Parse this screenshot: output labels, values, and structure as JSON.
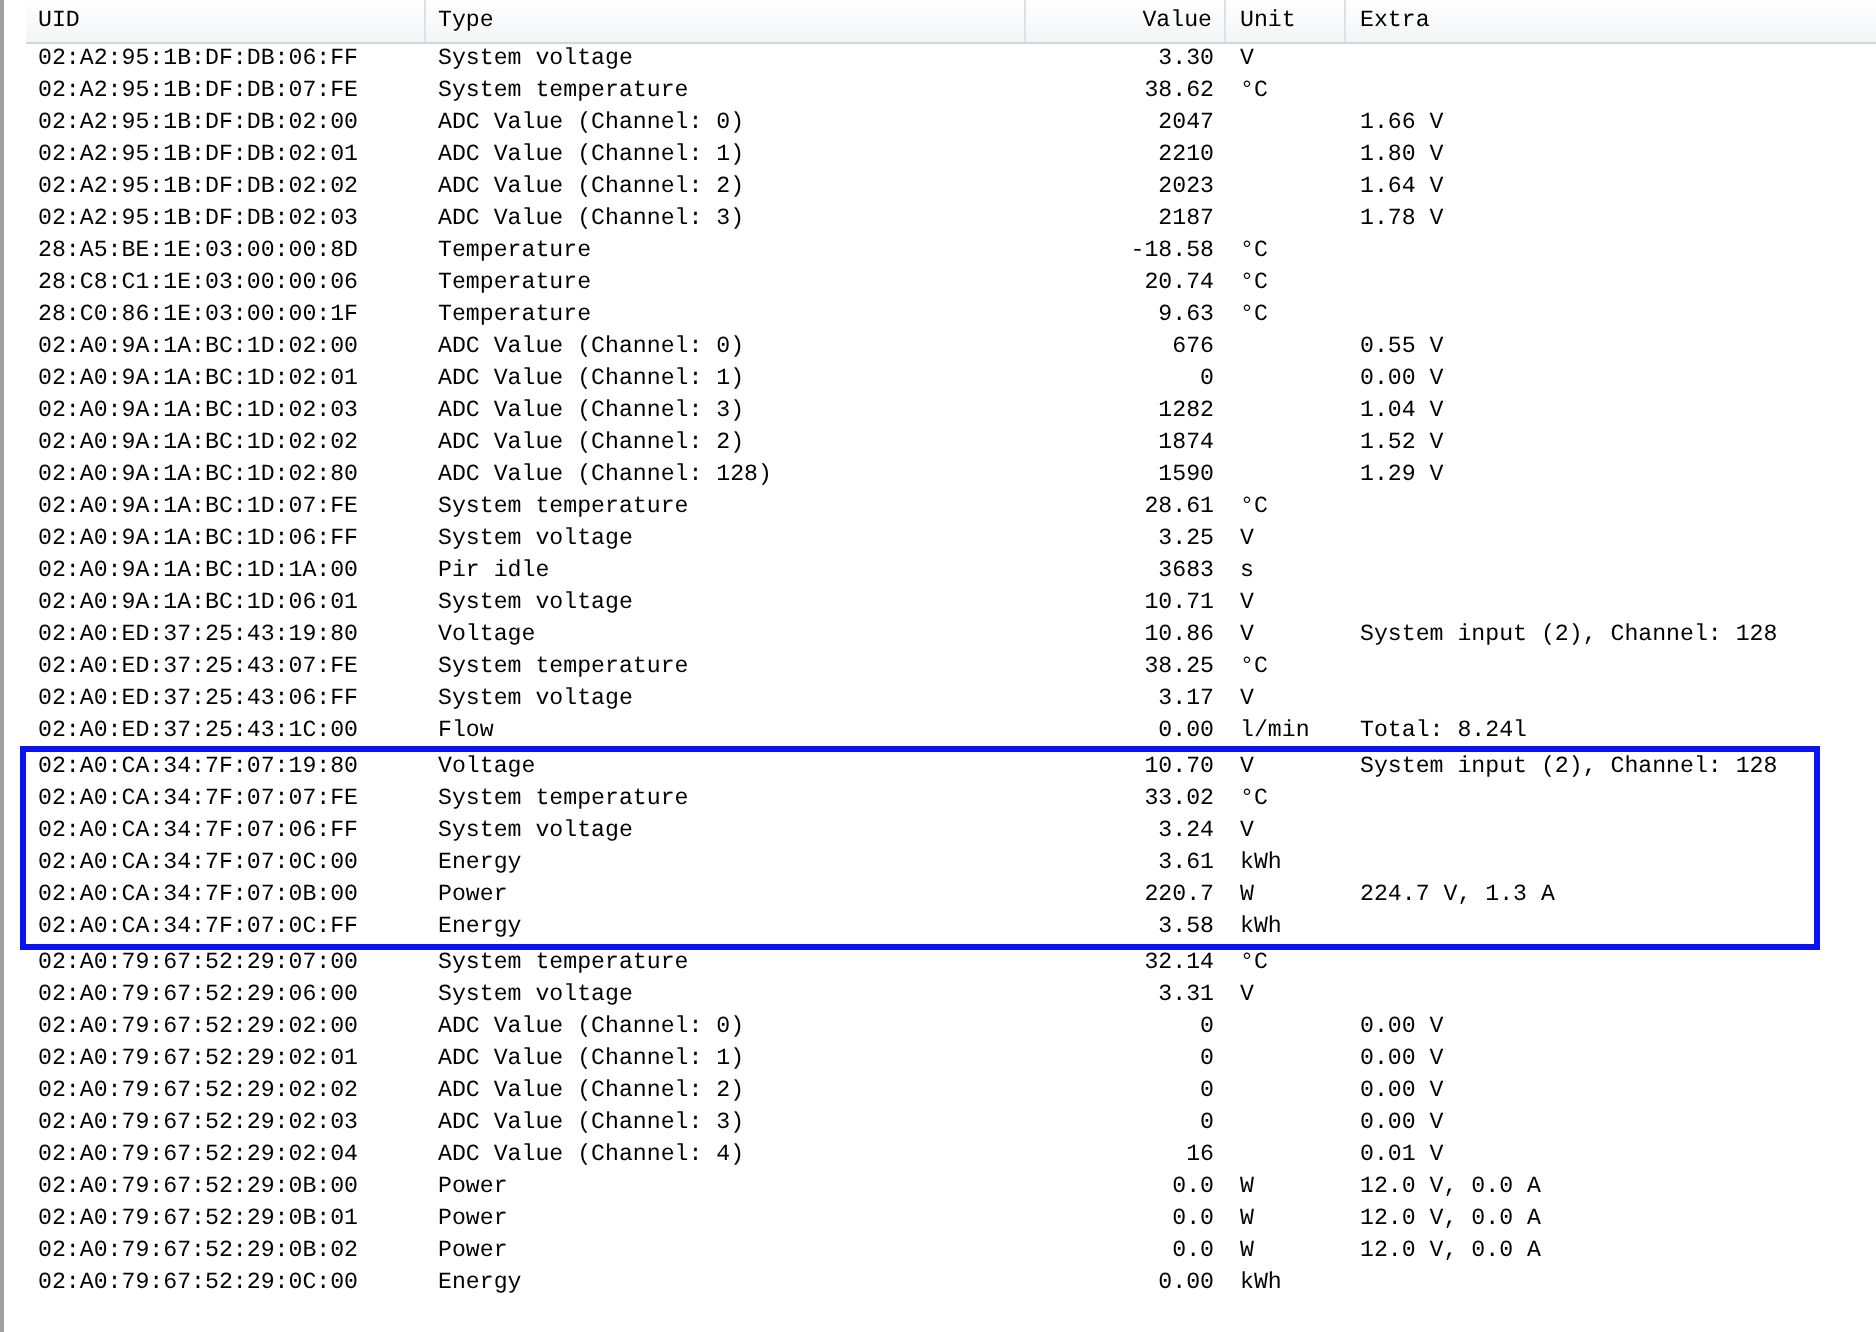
{
  "table": {
    "columns": [
      {
        "label": "UID"
      },
      {
        "label": "Type"
      },
      {
        "label": "Value"
      },
      {
        "label": "Unit"
      },
      {
        "label": "Extra"
      }
    ],
    "rows": [
      {
        "cells": [
          "02:A2:95:1B:DF:DB:06:FF",
          "System voltage",
          "3.30",
          "V",
          ""
        ],
        "highlighted": false
      },
      {
        "cells": [
          "02:A2:95:1B:DF:DB:07:FE",
          "System temperature",
          "38.62",
          "°C",
          ""
        ],
        "highlighted": false
      },
      {
        "cells": [
          "02:A2:95:1B:DF:DB:02:00",
          "ADC Value (Channel: 0)",
          "2047",
          "",
          "1.66 V"
        ],
        "highlighted": false
      },
      {
        "cells": [
          "02:A2:95:1B:DF:DB:02:01",
          "ADC Value (Channel: 1)",
          "2210",
          "",
          "1.80 V"
        ],
        "highlighted": false
      },
      {
        "cells": [
          "02:A2:95:1B:DF:DB:02:02",
          "ADC Value (Channel: 2)",
          "2023",
          "",
          "1.64 V"
        ],
        "highlighted": false
      },
      {
        "cells": [
          "02:A2:95:1B:DF:DB:02:03",
          "ADC Value (Channel: 3)",
          "2187",
          "",
          "1.78 V"
        ],
        "highlighted": false
      },
      {
        "cells": [
          "28:A5:BE:1E:03:00:00:8D",
          "Temperature",
          "-18.58",
          "°C",
          ""
        ],
        "highlighted": false
      },
      {
        "cells": [
          "28:C8:C1:1E:03:00:00:06",
          "Temperature",
          "20.74",
          "°C",
          ""
        ],
        "highlighted": false
      },
      {
        "cells": [
          "28:C0:86:1E:03:00:00:1F",
          "Temperature",
          "9.63",
          "°C",
          ""
        ],
        "highlighted": false
      },
      {
        "cells": [
          "02:A0:9A:1A:BC:1D:02:00",
          "ADC Value (Channel: 0)",
          "676",
          "",
          "0.55 V"
        ],
        "highlighted": false
      },
      {
        "cells": [
          "02:A0:9A:1A:BC:1D:02:01",
          "ADC Value (Channel: 1)",
          "0",
          "",
          "0.00 V"
        ],
        "highlighted": false
      },
      {
        "cells": [
          "02:A0:9A:1A:BC:1D:02:03",
          "ADC Value (Channel: 3)",
          "1282",
          "",
          "1.04 V"
        ],
        "highlighted": false
      },
      {
        "cells": [
          "02:A0:9A:1A:BC:1D:02:02",
          "ADC Value (Channel: 2)",
          "1874",
          "",
          "1.52 V"
        ],
        "highlighted": false
      },
      {
        "cells": [
          "02:A0:9A:1A:BC:1D:02:80",
          "ADC Value (Channel: 128)",
          "1590",
          "",
          "1.29 V"
        ],
        "highlighted": false
      },
      {
        "cells": [
          "02:A0:9A:1A:BC:1D:07:FE",
          "System temperature",
          "28.61",
          "°C",
          ""
        ],
        "highlighted": false
      },
      {
        "cells": [
          "02:A0:9A:1A:BC:1D:06:FF",
          "System voltage",
          "3.25",
          "V",
          ""
        ],
        "highlighted": false
      },
      {
        "cells": [
          "02:A0:9A:1A:BC:1D:1A:00",
          "Pir idle",
          "3683",
          "s",
          ""
        ],
        "highlighted": false
      },
      {
        "cells": [
          "02:A0:9A:1A:BC:1D:06:01",
          "System voltage",
          "10.71",
          "V",
          ""
        ],
        "highlighted": false
      },
      {
        "cells": [
          "02:A0:ED:37:25:43:19:80",
          "Voltage",
          "10.86",
          "V",
          "System input (2), Channel: 128"
        ],
        "highlighted": false
      },
      {
        "cells": [
          "02:A0:ED:37:25:43:07:FE",
          "System temperature",
          "38.25",
          "°C",
          ""
        ],
        "highlighted": false
      },
      {
        "cells": [
          "02:A0:ED:37:25:43:06:FF",
          "System voltage",
          "3.17",
          "V",
          ""
        ],
        "highlighted": false
      },
      {
        "cells": [
          "02:A0:ED:37:25:43:1C:00",
          "Flow",
          "0.00",
          "l/min",
          "Total: 8.24l"
        ],
        "highlighted": false
      },
      {
        "cells": [
          "02:A0:CA:34:7F:07:19:80",
          "Voltage",
          "10.70",
          "V",
          "System input (2), Channel: 128"
        ],
        "highlighted": true
      },
      {
        "cells": [
          "02:A0:CA:34:7F:07:07:FE",
          "System temperature",
          "33.02",
          "°C",
          ""
        ],
        "highlighted": true
      },
      {
        "cells": [
          "02:A0:CA:34:7F:07:06:FF",
          "System voltage",
          "3.24",
          "V",
          ""
        ],
        "highlighted": true
      },
      {
        "cells": [
          "02:A0:CA:34:7F:07:0C:00",
          "Energy",
          "3.61",
          "kWh",
          ""
        ],
        "highlighted": true
      },
      {
        "cells": [
          "02:A0:CA:34:7F:07:0B:00",
          "Power",
          "220.7",
          "W",
          "224.7 V, 1.3 A"
        ],
        "highlighted": true
      },
      {
        "cells": [
          "02:A0:CA:34:7F:07:0C:FF",
          "Energy",
          "3.58",
          "kWh",
          ""
        ],
        "highlighted": true
      },
      {
        "cells": [
          "02:A0:79:67:52:29:07:00",
          "System temperature",
          "32.14",
          "°C",
          ""
        ],
        "highlighted": false
      },
      {
        "cells": [
          "02:A0:79:67:52:29:06:00",
          "System voltage",
          "3.31",
          "V",
          ""
        ],
        "highlighted": false
      },
      {
        "cells": [
          "02:A0:79:67:52:29:02:00",
          "ADC Value (Channel: 0)",
          "0",
          "",
          "0.00 V"
        ],
        "highlighted": false
      },
      {
        "cells": [
          "02:A0:79:67:52:29:02:01",
          "ADC Value (Channel: 1)",
          "0",
          "",
          "0.00 V"
        ],
        "highlighted": false
      },
      {
        "cells": [
          "02:A0:79:67:52:29:02:02",
          "ADC Value (Channel: 2)",
          "0",
          "",
          "0.00 V"
        ],
        "highlighted": false
      },
      {
        "cells": [
          "02:A0:79:67:52:29:02:03",
          "ADC Value (Channel: 3)",
          "0",
          "",
          "0.00 V"
        ],
        "highlighted": false
      },
      {
        "cells": [
          "02:A0:79:67:52:29:02:04",
          "ADC Value (Channel: 4)",
          "16",
          "",
          "0.01 V"
        ],
        "highlighted": false
      },
      {
        "cells": [
          "02:A0:79:67:52:29:0B:00",
          "Power",
          "0.0",
          "W",
          "12.0 V, 0.0 A"
        ],
        "highlighted": false
      },
      {
        "cells": [
          "02:A0:79:67:52:29:0B:01",
          "Power",
          "0.0",
          "W",
          "12.0 V, 0.0 A"
        ],
        "highlighted": false
      },
      {
        "cells": [
          "02:A0:79:67:52:29:0B:02",
          "Power",
          "0.0",
          "W",
          "12.0 V, 0.0 A"
        ],
        "highlighted": false
      },
      {
        "cells": [
          "02:A0:79:67:52:29:0C:00",
          "Energy",
          "0.00",
          "kWh",
          ""
        ],
        "highlighted": false
      }
    ]
  }
}
